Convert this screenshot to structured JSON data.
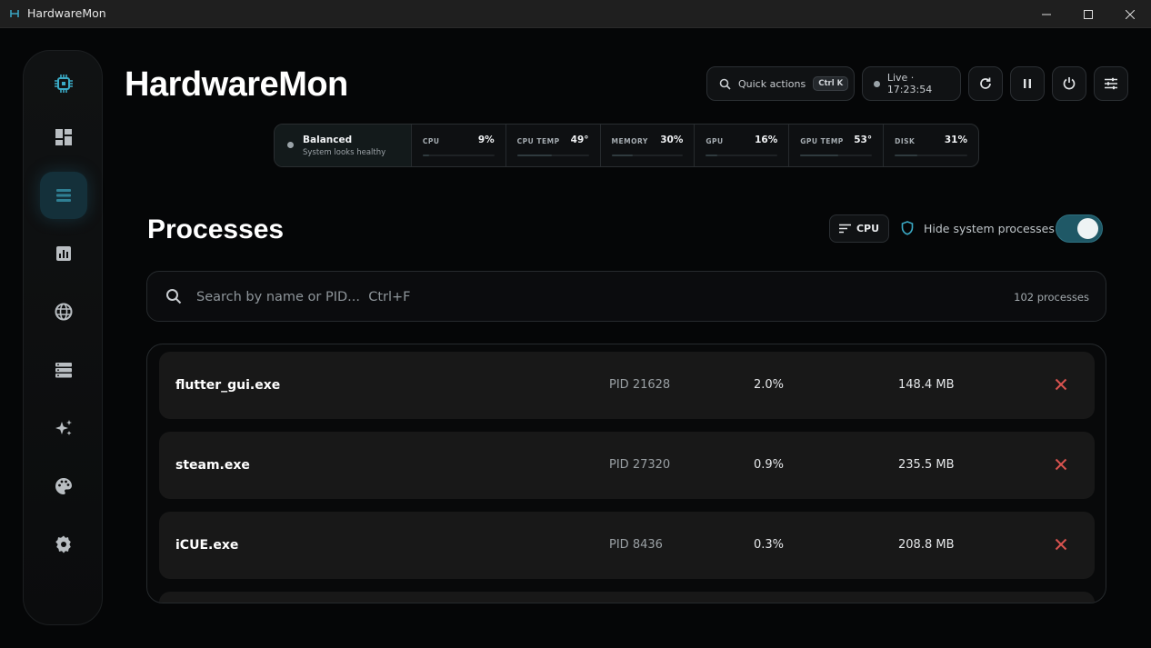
{
  "window": {
    "title": "HardwareMon"
  },
  "brand": "HardwareMon",
  "toolbar": {
    "quick_actions": "Quick actions",
    "quick_actions_shortcut": "Ctrl K",
    "live_status": "Live · 17:23:54"
  },
  "status": {
    "mode": "Balanced",
    "mode_sub": "System looks healthy",
    "metrics": [
      {
        "label": "CPU",
        "value": "9%",
        "level": 0.09
      },
      {
        "label": "CPU TEMP",
        "value": "49°",
        "level": 0.49
      },
      {
        "label": "MEMORY",
        "value": "30%",
        "level": 0.3
      },
      {
        "label": "GPU",
        "value": "16%",
        "level": 0.16
      },
      {
        "label": "GPU TEMP",
        "value": "53°",
        "level": 0.53
      },
      {
        "label": "DISK",
        "value": "31%",
        "level": 0.31
      }
    ]
  },
  "page": {
    "title": "Processes",
    "sort_label": "CPU",
    "hide_system_label": "Hide system processes",
    "hide_system_enabled": true
  },
  "search": {
    "placeholder": "Search by name or PID...  Ctrl+F",
    "value": "",
    "count": "102 processes"
  },
  "processes": [
    {
      "name": "flutter_gui.exe",
      "pid": "PID 21628",
      "cpu": "2.0%",
      "mem": "148.4 MB"
    },
    {
      "name": "steam.exe",
      "pid": "PID 27320",
      "cpu": "0.9%",
      "mem": "235.5 MB"
    },
    {
      "name": "iCUE.exe",
      "pid": "PID 8436",
      "cpu": "0.3%",
      "mem": "208.8 MB"
    }
  ],
  "nav": [
    {
      "name": "cpu-chip-icon"
    },
    {
      "name": "dashboard-icon"
    },
    {
      "name": "processes-icon"
    },
    {
      "name": "analytics-icon"
    },
    {
      "name": "globe-icon"
    },
    {
      "name": "storage-icon"
    },
    {
      "name": "sparkle-icon"
    },
    {
      "name": "palette-icon"
    },
    {
      "name": "gear-icon"
    }
  ],
  "colors": {
    "accent": "#2a8ea4",
    "kill": "#d9534f",
    "toggle_on": "#1f5866"
  }
}
